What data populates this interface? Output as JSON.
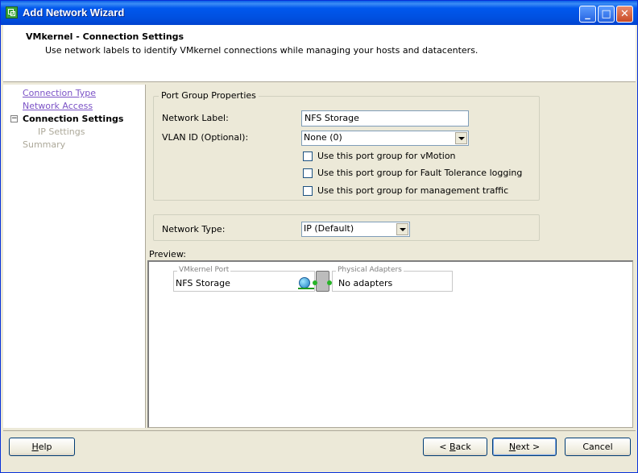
{
  "window": {
    "title": "Add Network Wizard",
    "controls": {
      "minimize": "_",
      "maximize": "□",
      "close": "✕"
    }
  },
  "header": {
    "title": "VMkernel - Connection Settings",
    "subtitle": "Use network labels to identify VMkernel connections while managing your hosts and datacenters."
  },
  "nav": {
    "items": [
      {
        "label": "Connection Type",
        "state": "link"
      },
      {
        "label": "Network Access",
        "state": "link"
      },
      {
        "label": "Connection Settings",
        "state": "current",
        "toggle": "−"
      },
      {
        "label": "IP Settings",
        "state": "disabled"
      },
      {
        "label": "Summary",
        "state": "disabled"
      }
    ]
  },
  "port_group": {
    "legend": "Port Group Properties",
    "network_label": {
      "label": "Network Label:",
      "value": "NFS Storage"
    },
    "vlan_id": {
      "label": "VLAN ID (Optional):",
      "value": "None (0)"
    },
    "checkboxes": [
      {
        "label": "Use this port group for vMotion",
        "checked": false
      },
      {
        "label": "Use this port group for Fault Tolerance logging",
        "checked": false
      },
      {
        "label": "Use this port group for management traffic",
        "checked": false
      }
    ]
  },
  "network_type": {
    "label": "Network Type:",
    "value": "IP (Default)"
  },
  "preview": {
    "label": "Preview:",
    "vmkernel_port": {
      "legend": "VMkernel Port",
      "name": "NFS Storage",
      "icon": "globe-network-icon"
    },
    "physical_adapters": {
      "legend": "Physical Adapters",
      "value": "No adapters"
    },
    "colors": {
      "link": "#1f9a1f",
      "switch": "#bcbcbc"
    }
  },
  "buttons": {
    "help": {
      "prefix": "",
      "hotkey": "H",
      "rest": "elp"
    },
    "back": {
      "prefix": "< ",
      "hotkey": "B",
      "rest": "ack"
    },
    "next": {
      "prefix": "",
      "hotkey": "N",
      "rest": "ext >"
    },
    "cancel": {
      "prefix": "",
      "hotkey": "",
      "rest": "Cancel"
    }
  },
  "colors": {
    "accent": "#0054e3",
    "link": "#7b52c6",
    "disabled": "#aca899"
  }
}
